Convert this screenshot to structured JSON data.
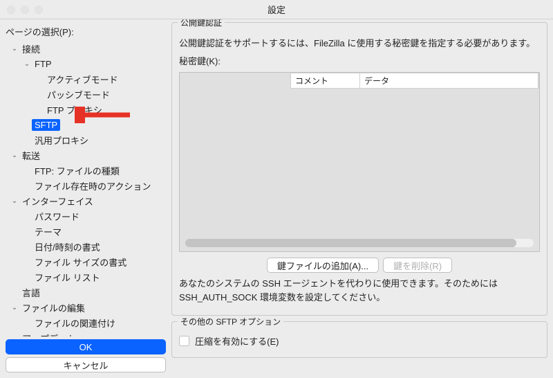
{
  "window": {
    "title": "設定"
  },
  "sidebar": {
    "label": "ページの選択(P):",
    "items": [
      {
        "label": "接続",
        "depth": 0,
        "expanded": true
      },
      {
        "label": "FTP",
        "depth": 1,
        "expanded": true
      },
      {
        "label": "アクティブモード",
        "depth": 2
      },
      {
        "label": "パッシブモード",
        "depth": 2
      },
      {
        "label": "FTP プロキシ",
        "depth": 2
      },
      {
        "label": "SFTP",
        "depth": 1,
        "selected": true
      },
      {
        "label": "汎用プロキシ",
        "depth": 1
      },
      {
        "label": "転送",
        "depth": 0,
        "expanded": true
      },
      {
        "label": "FTP: ファイルの種類",
        "depth": 1
      },
      {
        "label": "ファイル存在時のアクション",
        "depth": 1
      },
      {
        "label": "インターフェイス",
        "depth": 0,
        "expanded": true
      },
      {
        "label": "パスワード",
        "depth": 1
      },
      {
        "label": "テーマ",
        "depth": 1
      },
      {
        "label": "日付/時刻の書式",
        "depth": 1
      },
      {
        "label": "ファイル サイズの書式",
        "depth": 1
      },
      {
        "label": "ファイル リスト",
        "depth": 1
      },
      {
        "label": "言語",
        "depth": 0
      },
      {
        "label": "ファイルの編集",
        "depth": 0,
        "expanded": true
      },
      {
        "label": "ファイルの関連付け",
        "depth": 1
      },
      {
        "label": "アップデート",
        "depth": 0
      }
    ],
    "ok_label": "OK",
    "cancel_label": "キャンセル"
  },
  "main": {
    "group1": {
      "title": "公開鍵認証",
      "intro": "公開鍵認証をサポートするには、FileZilla に使用する秘密鍵を指定する必要があります。",
      "keys_label": "秘密鍵(K):",
      "col_comment": "コメント",
      "col_data": "データ",
      "add_label": "鍵ファイルの追加(A)...",
      "remove_label": "鍵を削除(R)",
      "agent_text": "あなたのシステムの SSH エージェントを代わりに使用できます。そのためには SSH_AUTH_SOCK 環境変数を設定してください。"
    },
    "group2": {
      "title": "その他の SFTP オプション",
      "compress_label": "圧縮を有効にする(E)"
    }
  }
}
